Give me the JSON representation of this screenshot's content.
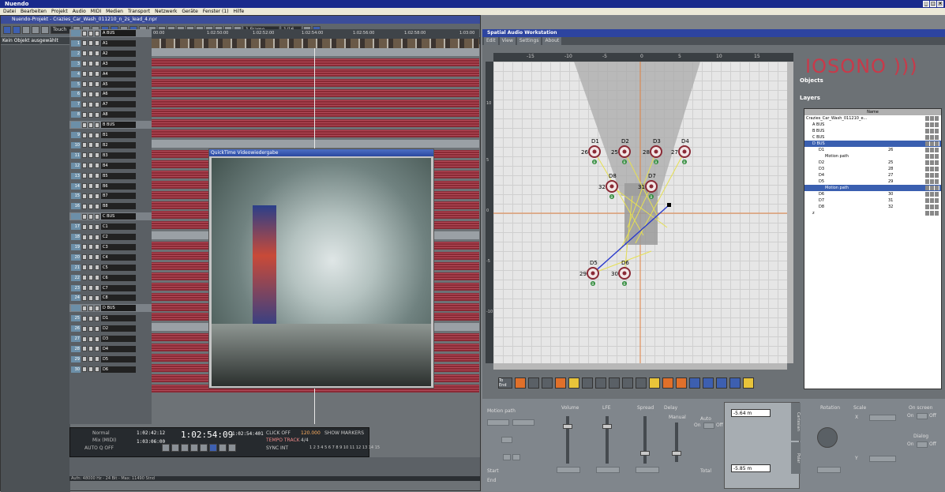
{
  "app_title": "Nuendo",
  "menu": [
    "Datei",
    "Bearbeiten",
    "Projekt",
    "Audio",
    "MIDI",
    "Medien",
    "Transport",
    "Netzwerk",
    "Geräte",
    "Fenster (1)",
    "Hilfe"
  ],
  "project_window": {
    "title": "Nuendo-Projekt - Crazies_Car_Wash_011210_n_2s_lead_4.npr",
    "touch_mode": "Touch",
    "frame_label": "1 Frame",
    "quantize": "1/16",
    "info_line": "Kein Objekt ausgewählt",
    "ruler_ticks": [
      "00:00",
      "1:02:50:00",
      "1:02:52:00",
      "1:02:54:00",
      "1:02:56:00",
      "1:02:58:00",
      "1:03:00"
    ],
    "tracks": [
      {
        "num": "",
        "name": "A BUS",
        "group": true
      },
      {
        "num": "1",
        "name": "A1",
        "group": false
      },
      {
        "num": "2",
        "name": "A2",
        "group": false
      },
      {
        "num": "3",
        "name": "A3",
        "group": false
      },
      {
        "num": "4",
        "name": "A4",
        "group": false
      },
      {
        "num": "5",
        "name": "A5",
        "group": false
      },
      {
        "num": "6",
        "name": "A6",
        "group": false
      },
      {
        "num": "7",
        "name": "A7",
        "group": false
      },
      {
        "num": "8",
        "name": "A8",
        "group": false
      },
      {
        "num": "",
        "name": "B BUS",
        "group": true
      },
      {
        "num": "9",
        "name": "B1",
        "group": false
      },
      {
        "num": "10",
        "name": "B2",
        "group": false
      },
      {
        "num": "11",
        "name": "B3",
        "group": false
      },
      {
        "num": "12",
        "name": "B4",
        "group": false
      },
      {
        "num": "13",
        "name": "B5",
        "group": false
      },
      {
        "num": "14",
        "name": "B6",
        "group": false
      },
      {
        "num": "15",
        "name": "B7",
        "group": false
      },
      {
        "num": "16",
        "name": "B8",
        "group": false
      },
      {
        "num": "",
        "name": "C BUS",
        "group": true
      },
      {
        "num": "17",
        "name": "C1",
        "group": false
      },
      {
        "num": "18",
        "name": "C2",
        "group": false
      },
      {
        "num": "19",
        "name": "C3",
        "group": false
      },
      {
        "num": "20",
        "name": "C4",
        "group": false
      },
      {
        "num": "21",
        "name": "C5",
        "group": false
      },
      {
        "num": "22",
        "name": "C6",
        "group": false
      },
      {
        "num": "23",
        "name": "C7",
        "group": false
      },
      {
        "num": "24",
        "name": "C8",
        "group": false
      },
      {
        "num": "",
        "name": "D BUS",
        "group": true
      },
      {
        "num": "25",
        "name": "D1",
        "group": false
      },
      {
        "num": "26",
        "name": "D2",
        "group": false
      },
      {
        "num": "27",
        "name": "D3",
        "group": false
      },
      {
        "num": "28",
        "name": "D4",
        "group": false
      },
      {
        "num": "29",
        "name": "D5",
        "group": false
      },
      {
        "num": "30",
        "name": "D6",
        "group": false
      }
    ],
    "transport": {
      "left_locator": "1:02:42:12",
      "right_locator": "1:03:06:00",
      "main_time": "1:02:54:09",
      "secondary_time": "1:02:54:401",
      "tempo": "120.000",
      "signature": "4/4",
      "mode": "Normal",
      "mix": "Mix (MIDI)",
      "auto_q": "AUTO Q  OFF",
      "click": "CLICK OFF",
      "tempo_label": "TEMPO TRACK",
      "sync": "SYNC INT",
      "show_markers": "SHOW MARKERS",
      "marker_numbers": "1 2 3 4 5 6 7 8 9 10 11 12 13 14 15"
    },
    "status_line": "Aufn: 48000 Hz - 24 Bit - Max: 11490 Stnd"
  },
  "video_window": {
    "title": "QuickTime Videowiedergabe"
  },
  "spatial": {
    "title": "Spatial Audio Workstation",
    "menu": [
      "Edit",
      "View",
      "Settings",
      "About"
    ],
    "ruler_h": [
      "-15",
      "-10",
      "-5",
      "0",
      "5",
      "10",
      "15"
    ],
    "ruler_v": [
      "10",
      "5",
      "0",
      "-5",
      "-10"
    ],
    "logo": "IOSONO )))",
    "objects_label": "Objects",
    "layers_label": "Layers",
    "tree_header": "Name",
    "tree": [
      {
        "text": "Crazies_Car_Wash_011210_e...",
        "val": "",
        "indent": 0,
        "sel": false
      },
      {
        "text": "A BUS",
        "val": "",
        "indent": 1,
        "sel": false
      },
      {
        "text": "B BUS",
        "val": "",
        "indent": 1,
        "sel": false
      },
      {
        "text": "C BUS",
        "val": "",
        "indent": 1,
        "sel": false
      },
      {
        "text": "D BUS",
        "val": "",
        "indent": 1,
        "sel": true
      },
      {
        "text": "D1",
        "val": "26",
        "indent": 2,
        "sel": false
      },
      {
        "text": "Motion path",
        "val": "",
        "indent": 3,
        "sel": false
      },
      {
        "text": "D2",
        "val": "25",
        "indent": 2,
        "sel": false
      },
      {
        "text": "D3",
        "val": "28",
        "indent": 2,
        "sel": false
      },
      {
        "text": "D4",
        "val": "27",
        "indent": 2,
        "sel": false
      },
      {
        "text": "D5",
        "val": "29",
        "indent": 2,
        "sel": false
      },
      {
        "text": "Motion path",
        "val": "",
        "indent": 3,
        "sel": true
      },
      {
        "text": "D6",
        "val": "30",
        "indent": 2,
        "sel": false
      },
      {
        "text": "D7",
        "val": "31",
        "indent": 2,
        "sel": false
      },
      {
        "text": "D8",
        "val": "32",
        "indent": 2,
        "sel": false
      },
      {
        "text": "z",
        "val": "",
        "indent": 1,
        "sel": false
      }
    ],
    "sources": [
      {
        "name": "D1",
        "num": "26"
      },
      {
        "name": "D2",
        "num": "25"
      },
      {
        "name": "D3",
        "num": "28"
      },
      {
        "name": "D4",
        "num": "27"
      },
      {
        "name": "D8",
        "num": "32"
      },
      {
        "name": "D7",
        "num": "31"
      },
      {
        "name": "D5",
        "num": "29"
      },
      {
        "name": "D6",
        "num": "30"
      }
    ],
    "source_badge": "B",
    "control": {
      "motion_path": "Motion path",
      "volume": "Volume",
      "lfe": "LFE",
      "spread": "Spread",
      "delay": "Delay",
      "manual": "Manual",
      "auto": "Auto",
      "on": "On",
      "off": "Off",
      "start": "Start",
      "end": "End",
      "total": "Total",
      "x_value": "-5.64 m",
      "y_value": "-5.85 m",
      "cartesian": "Cartesian",
      "polar": "Polar",
      "rotation": "Rotation",
      "scale": "Scale",
      "x_label": "X",
      "y_label": "Y",
      "on_screen": "On screen",
      "dialog": "Dialog",
      "to_end": "To End"
    }
  },
  "colors": {
    "accent_blue": "#2d44a0",
    "track_red": "#8a2a35",
    "logo_red": "#c83a4a"
  }
}
